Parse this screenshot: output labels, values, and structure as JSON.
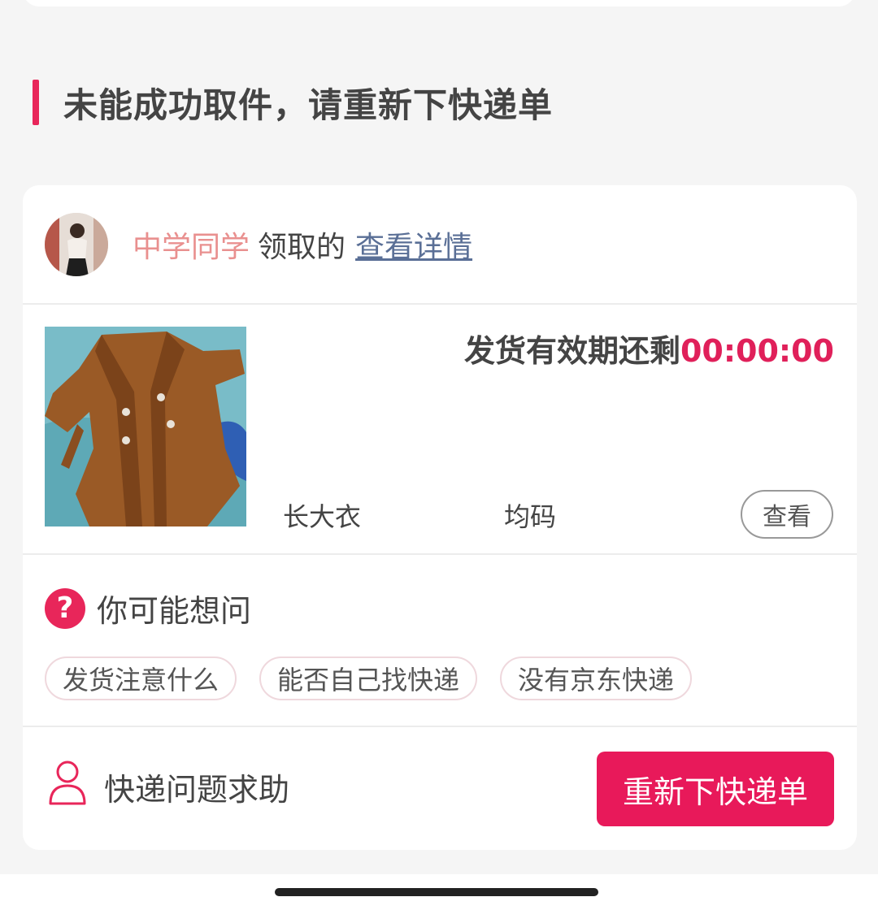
{
  "section": {
    "title": "未能成功取件，请重新下快递单",
    "accent_color": "#e8265a"
  },
  "receiver": {
    "avatar_icon": "user-avatar",
    "name": "中学同学",
    "verb": "领取的",
    "detail_link": "查看详情"
  },
  "product": {
    "image_icon": "brown-coat-photo",
    "countdown_label": "发货有效期还剩",
    "countdown_time": "00:00:00",
    "name": "长大衣",
    "size": "均码",
    "view_button": "查看"
  },
  "faq": {
    "icon": "question-icon",
    "title": "你可能想问",
    "chips": [
      "发货注意什么",
      "能否自己找快递",
      "没有京东快递"
    ]
  },
  "help": {
    "icon": "person-icon",
    "label": "快递问题求助",
    "action_button": "重新下快递单",
    "button_color": "#e8195a"
  }
}
